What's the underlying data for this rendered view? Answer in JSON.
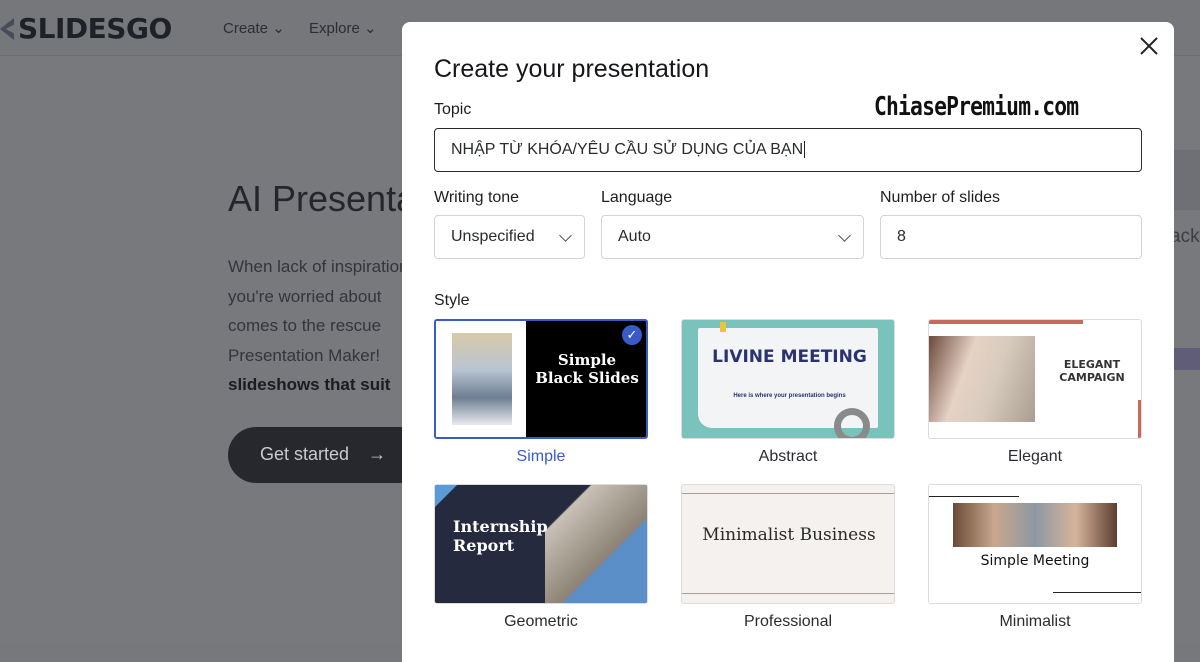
{
  "nav": {
    "logo": "SLIDESGO",
    "items": [
      "Create",
      "Explore"
    ]
  },
  "hero": {
    "title": "AI Presentation Maker",
    "lines": [
      "When lack of inspiration or time",
      "you're worried about",
      "comes to the rescue",
      "Presentation Maker!"
    ],
    "bold_line": "slideshows that suit",
    "cta": "Get started",
    "cta_icon": "arrow-right-icon",
    "side_text": "ack"
  },
  "watermark": "ChiasePremium.com",
  "modal": {
    "title": "Create your presentation",
    "topic": {
      "label": "Topic",
      "value": "NHẬP TỪ KHÓA/YÊU CẦU SỬ DỤNG CỦA BẠN"
    },
    "tone": {
      "label": "Writing tone",
      "value": "Unspecified"
    },
    "language": {
      "label": "Language",
      "value": "Auto"
    },
    "slides": {
      "label": "Number of slides",
      "value": "8"
    },
    "style_label": "Style",
    "styles": [
      {
        "name": "Simple",
        "thumb": "Simple Black Slides",
        "selected": true
      },
      {
        "name": "Abstract",
        "thumb": "LIVINE MEETING",
        "sub": "Here is where your presentation begins"
      },
      {
        "name": "Elegant",
        "thumb": "ELEGANT CAMPAIGN"
      },
      {
        "name": "Geometric",
        "thumb": "Internship Report"
      },
      {
        "name": "Professional",
        "thumb": "Minimalist Business"
      },
      {
        "name": "Minimalist",
        "thumb": "Simple Meeting"
      }
    ],
    "accent": "#3a5bc7"
  }
}
